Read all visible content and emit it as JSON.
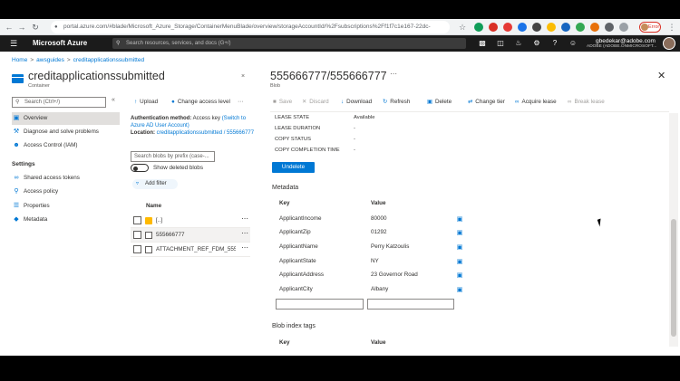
{
  "browser": {
    "url": "portal.azure.com/#blade/Microsoft_Azure_Storage/ContainerMenuBlade/overview/storageAccountId/%2Fsubscriptions%2Ff1f7c1e167-22dc-",
    "profile_label": "Error"
  },
  "topbar": {
    "brand": "Microsoft Azure",
    "search_placeholder": "Search resources, services, and docs (G+/)",
    "user_name": "gbedekar@adobe.com",
    "user_directory": "ADOBE (ADOBE.ONMICROSOFT..."
  },
  "breadcrumb": [
    "Home",
    "awsguides",
    "creditapplicationssubmitted"
  ],
  "container": {
    "title": "creditapplicationssubmitted",
    "type": "Container"
  },
  "left_menu": {
    "search_placeholder": "Search (Ctrl+/)",
    "items": [
      "Overview",
      "Diagnose and solve problems",
      "Access Control (IAM)"
    ],
    "settings_header": "Settings",
    "settings_items": [
      "Shared access tokens",
      "Access policy",
      "Properties",
      "Metadata"
    ]
  },
  "middle": {
    "upload": "Upload",
    "change_access_level": "Change access level",
    "auth_label": "Authentication method:",
    "auth_value": "Access key",
    "auth_link": "(Switch to Azure AD User Account)",
    "location_label": "Location:",
    "location_value": "creditapplicationssubmitted / 555666777",
    "blob_search_placeholder": "Search blobs by prefix (case-...",
    "show_deleted": "Show deleted blobs",
    "add_filter": "Add filter",
    "name_header": "Name",
    "rows": [
      "[..]",
      "555666777",
      "ATTACHMENT_REF_FDM_5556..."
    ]
  },
  "blade": {
    "title": "555666777/555666777",
    "type": "Blob",
    "commands": {
      "save": "Save",
      "discard": "Discard",
      "download": "Download",
      "refresh": "Refresh",
      "delete": "Delete",
      "change_tier": "Change tier",
      "acquire_lease": "Acquire lease",
      "break_lease": "Break lease"
    },
    "properties": [
      {
        "key": "LEASE STATE",
        "value": "Available"
      },
      {
        "key": "LEASE DURATION",
        "value": "-"
      },
      {
        "key": "COPY STATUS",
        "value": "-"
      },
      {
        "key": "COPY COMPLETION TIME",
        "value": "-"
      }
    ],
    "undelete": "Undelete",
    "metadata_title": "Metadata",
    "key_header": "Key",
    "value_header": "Value",
    "metadata": [
      {
        "key": "ApplicantIncome",
        "value": "80000"
      },
      {
        "key": "ApplicantZip",
        "value": "01292"
      },
      {
        "key": "ApplicantName",
        "value": "Perry Katzoulis"
      },
      {
        "key": "ApplicantState",
        "value": "NY"
      },
      {
        "key": "ApplicantAddress",
        "value": "23 Governor Road"
      },
      {
        "key": "ApplicantCity",
        "value": "Albany"
      }
    ],
    "index_tags_title": "Blob index tags",
    "tags_key_header": "Key",
    "tags_value_header": "Value"
  }
}
